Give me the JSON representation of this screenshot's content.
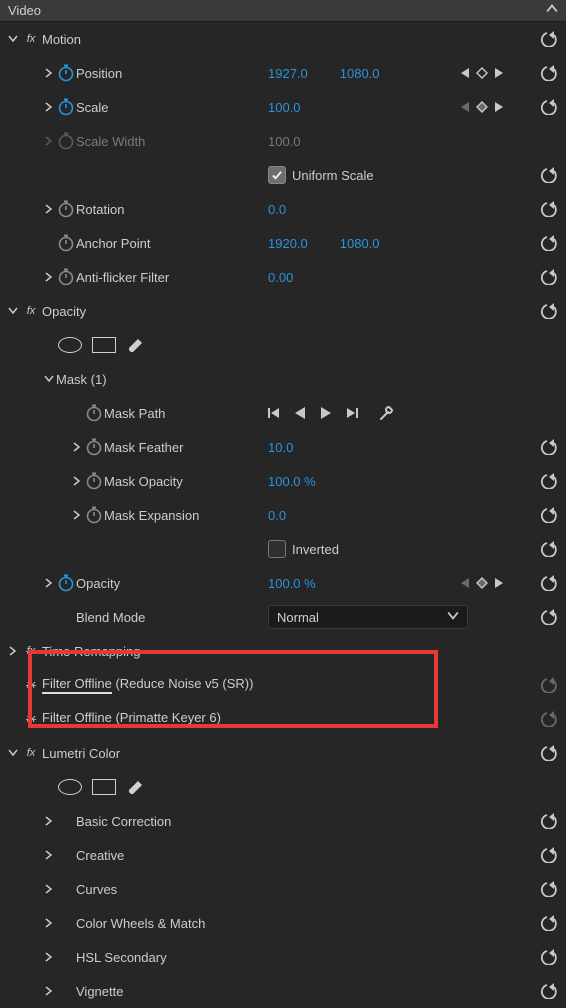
{
  "panel": {
    "title": "Video"
  },
  "motion": {
    "title": "Motion",
    "position": {
      "label": "Position",
      "x": "1927.0",
      "y": "1080.0"
    },
    "scale": {
      "label": "Scale",
      "value": "100.0"
    },
    "scale_width": {
      "label": "Scale Width",
      "value": "100.0"
    },
    "uniform": {
      "label": "Uniform Scale"
    },
    "rotation": {
      "label": "Rotation",
      "value": "0.0"
    },
    "anchor": {
      "label": "Anchor Point",
      "x": "1920.0",
      "y": "1080.0"
    },
    "antiflicker": {
      "label": "Anti-flicker Filter",
      "value": "0.00"
    }
  },
  "opacity": {
    "title": "Opacity",
    "mask": {
      "title": "Mask (1)",
      "path": {
        "label": "Mask Path"
      },
      "feather": {
        "label": "Mask Feather",
        "value": "10.0"
      },
      "opacity": {
        "label": "Mask Opacity",
        "value": "100.0 %"
      },
      "expansion": {
        "label": "Mask Expansion",
        "value": "0.0"
      },
      "inverted": {
        "label": "Inverted"
      }
    },
    "opacity": {
      "label": "Opacity",
      "value": "100.0 %"
    },
    "blend": {
      "label": "Blend Mode",
      "value": "Normal"
    }
  },
  "time_remap": {
    "title": "Time Remapping"
  },
  "offline1": {
    "prefix": "Filter Offline",
    "suffix": " (Reduce Noise v5 (SR))"
  },
  "offline2": {
    "prefix": "Filter Offline",
    "suffix": " (Primatte Keyer 6)"
  },
  "lumetri": {
    "title": "Lumetri Color",
    "sections": {
      "basic": "Basic Correction",
      "creative": "Creative",
      "curves": "Curves",
      "wheels": "Color Wheels & Match",
      "hsl": "HSL Secondary",
      "vignette": "Vignette"
    }
  }
}
